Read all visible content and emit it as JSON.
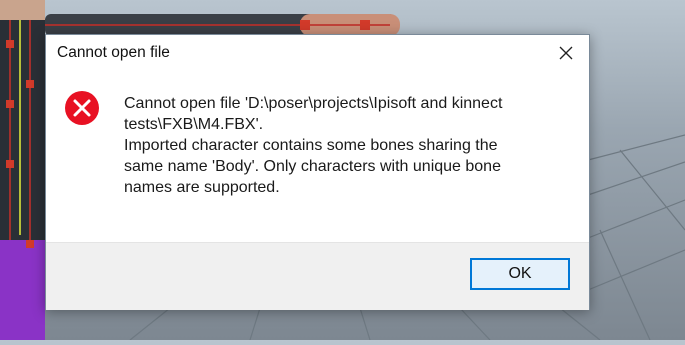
{
  "dialog": {
    "title": "Cannot open file",
    "icon": "error-icon",
    "message_lines": [
      "Cannot open file 'D:\\poser\\projects\\Ipisoft and kinnect",
      "tests\\FXB\\M4.FBX'.",
      "Imported character contains some bones sharing the",
      "same name 'Body'. Only characters with unique bone",
      "names are supported."
    ],
    "ok_label": "OK"
  },
  "colors": {
    "accent": "#0078d7",
    "error_red": "#e81123"
  }
}
